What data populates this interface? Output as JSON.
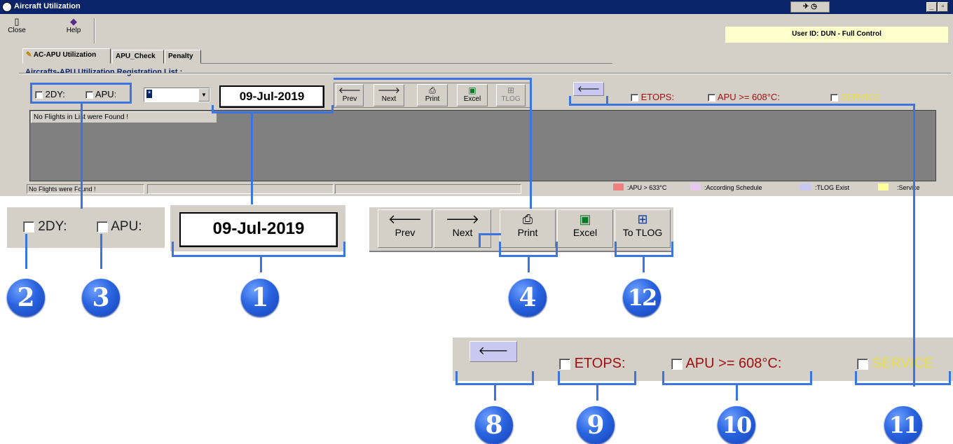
{
  "window": {
    "title": "Aircraft Utilization",
    "min": "_",
    "max": "▫"
  },
  "toolbar": {
    "close_label": "Close",
    "help_label": "Help"
  },
  "user": {
    "text": "User ID: DUN - Full Control"
  },
  "tabs": [
    "AC-APU Utilization",
    "APU_Check",
    "Penalty"
  ],
  "group_title": "Aircrafts-APU Utilization Registration List :",
  "filters": {
    "twody_label": "2DY:",
    "apu_label": "APU:",
    "combo_value": "*",
    "date": "09-Jul-2019"
  },
  "nav": {
    "prev": "Prev",
    "next": "Next",
    "print": "Print",
    "excel": "Excel",
    "tlog": "TLOG",
    "to_tlog": "To TLOG"
  },
  "options": {
    "etops": "ETOPS:",
    "apu_temp": "APU >= 608°C:",
    "service": "SERVICE"
  },
  "list": {
    "message": "No Flights in List were Found !"
  },
  "status": {
    "message": "No Flights were Found !"
  },
  "legend": [
    {
      "label": ":APU > 633°C",
      "color": "#f08080"
    },
    {
      "label": ":According Schedule",
      "color": "#e6c8f0"
    },
    {
      "label": ":TLOG Exist",
      "color": "#c8c8f0"
    },
    {
      "label": ":Service",
      "color": "#ffff99"
    }
  ],
  "callouts": [
    "1",
    "2",
    "3",
    "4",
    "8",
    "9",
    "10",
    "11",
    "12"
  ],
  "colors": {
    "accent": "#3c74e0",
    "service": "#e8e040",
    "red_text": "#a01010",
    "grid_bg": "#808080"
  }
}
